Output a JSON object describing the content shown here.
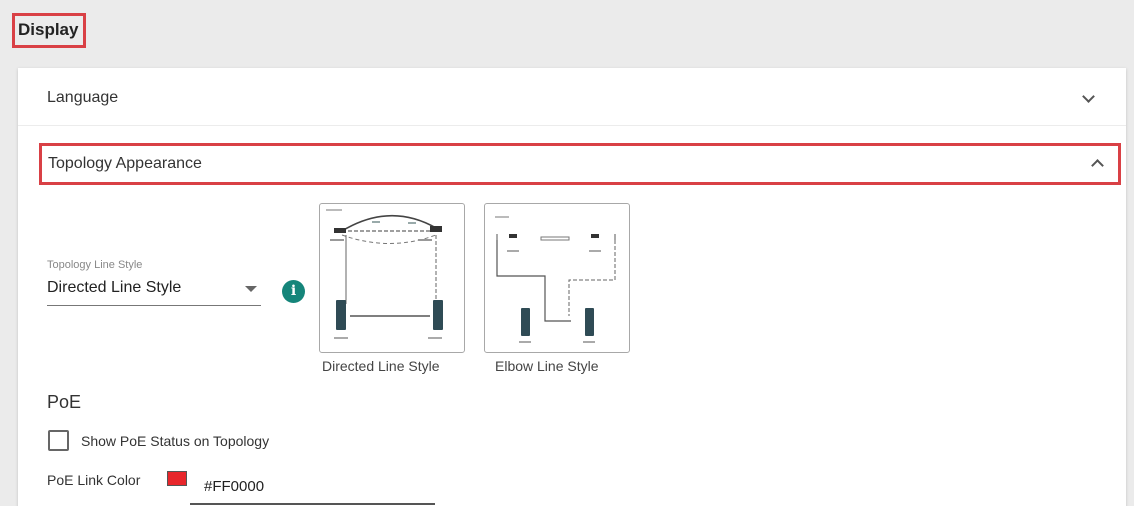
{
  "header": {
    "title": "Display"
  },
  "sections": {
    "language": {
      "label": "Language"
    },
    "topology_appearance": {
      "label": "Topology Appearance"
    }
  },
  "topology_line_style": {
    "label": "Topology Line Style",
    "value": "Directed Line Style",
    "options": [
      {
        "caption": "Directed Line Style"
      },
      {
        "caption": "Elbow Line Style"
      }
    ]
  },
  "poe": {
    "title": "PoE",
    "show_status_label": "Show PoE Status on Topology",
    "show_status_checked": false,
    "link_color_label": "PoE Link Color",
    "link_color_value": "#FF0000",
    "link_color": "#e8262b"
  },
  "colors": {
    "highlight": "#d94045",
    "info_icon": "#15857a"
  },
  "icons": [
    "chevron-down-icon",
    "chevron-up-icon",
    "dropdown-caret-icon",
    "info-icon"
  ]
}
